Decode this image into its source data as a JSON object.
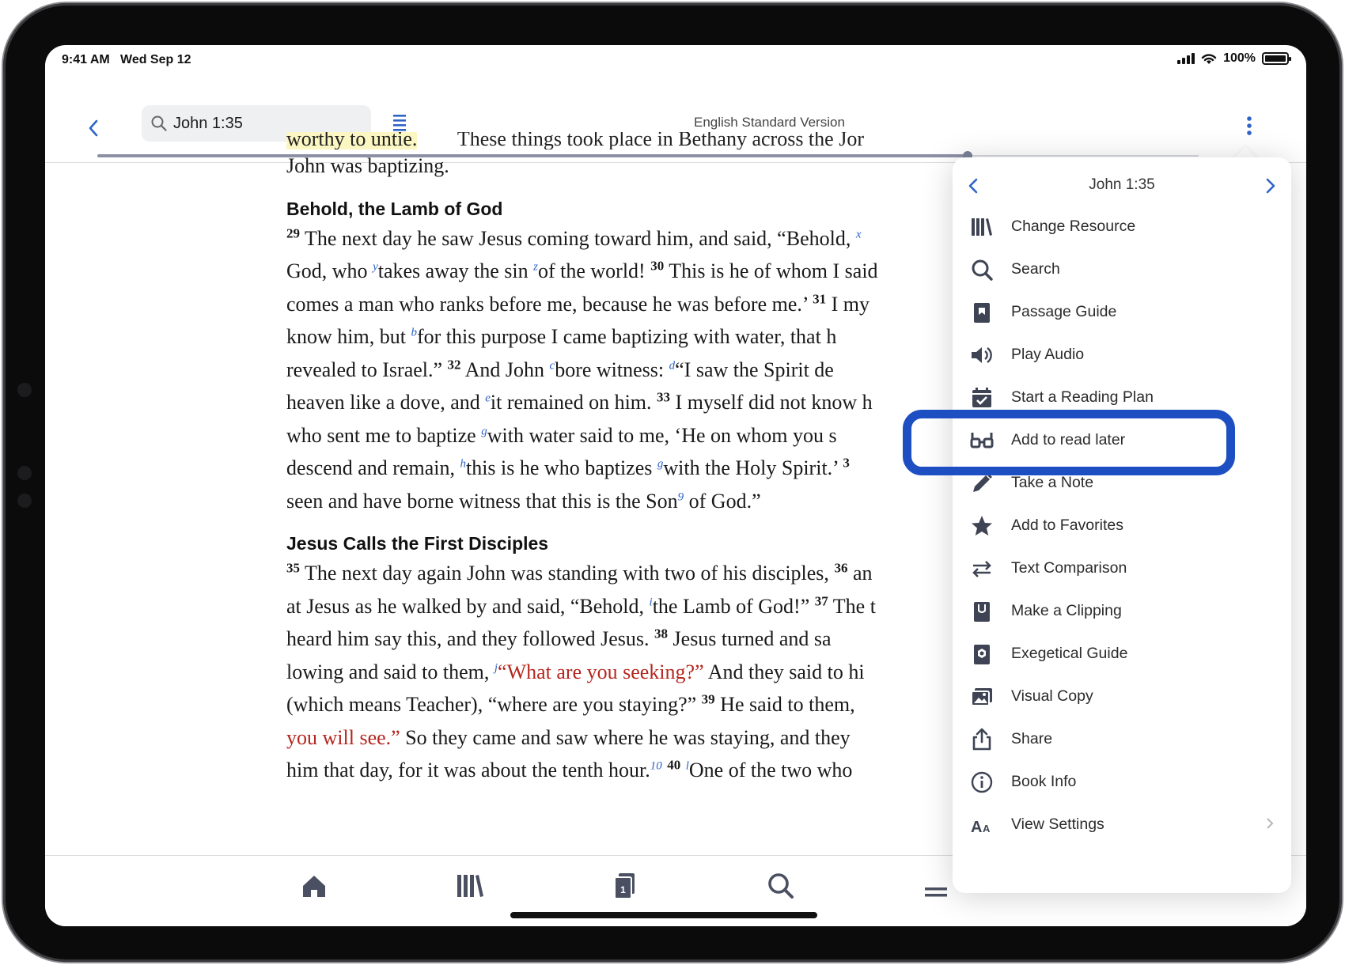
{
  "status_bar": {
    "time": "9:41 AM",
    "date": "Wed Sep 12",
    "battery": "100%"
  },
  "nav": {
    "search_value": "John 1:35",
    "version_title": "English Standard Version",
    "reading_progress": 0.79
  },
  "reader": {
    "cut_line_highlight": "worthy to untie.",
    "cut_line_rest": "These things took place in Bethany across the Jor",
    "line_intro": "John was baptizing.",
    "heading_1": "Behold, the Lamb of God",
    "heading_2": "Jesus Calls the First Disciples",
    "p1": {
      "l1a": "The next day he saw Jesus coming toward him, and said, “Behold,",
      "v29": "29",
      "fx": "x",
      "l2a": "God, who",
      "fy": "y",
      "l2b": "takes away the sin",
      "fz": "z",
      "l2c": "of the world!",
      "v30": "30",
      "l2d": "This is he of whom I said",
      "l3a": "comes a man who ranks before me, because he was before me.’",
      "v31": "31",
      "l3b": "I my",
      "l4a": "know him, but",
      "fb": "b",
      "l4b": "for this purpose I came baptizing with water, that h",
      "l5a": "revealed to Israel.”",
      "v32": "32",
      "l5b": "And John",
      "fc": "c",
      "l5c": "bore witness:",
      "fd": "d",
      "l5d": "“I saw the Spirit de",
      "l6a": "heaven like a dove, and",
      "fe": "e",
      "l6b": "it remained on him.",
      "v33": "33",
      "l6c": "I myself did not know h",
      "l7a": "who sent me to baptize",
      "fg": "g",
      "l7b": "with water said to me, ‘He on whom you s",
      "l8a": "descend and remain,",
      "fh": "h",
      "l8b": "this is he who baptizes",
      "fg2": "g",
      "l8c": "with the Holy Spirit.’",
      "v34": "3",
      "l9a": "seen and have borne witness that this is the Son",
      "f9": "9",
      "l9b": "of God.”"
    },
    "p2": {
      "v35": "35",
      "l1a": "The next day again John was standing with two of his disciples,",
      "v36": "36",
      "l1b": "an",
      "l2a": "at Jesus as he walked by and said, “Behold,",
      "fi": "i",
      "l2b": "the Lamb of God!”",
      "v37": "37",
      "l2c": "The t",
      "l3a": "heard him say this, and they followed Jesus.",
      "v38": "38",
      "l3b": "Jesus turned and sa",
      "l4a": "lowing and said to them,",
      "fj": "j",
      "l4red": "“What are you seeking?”",
      "l4b": "And they said to hi",
      "l5a": "(which means Teacher), “where are you staying?”",
      "v39": "39",
      "l5b": "He said to them,",
      "l6red": "you will see.”",
      "l6b": "So they came and saw where he was staying, and they",
      "l7a": "him that day, for it was about the tenth hour.",
      "f10": "10",
      "v40": "40",
      "fl": "l",
      "l7b": "One of the two who"
    }
  },
  "menu": {
    "title": "John 1:35",
    "items": [
      {
        "label": "Change Resource",
        "icon": "library-icon"
      },
      {
        "label": "Search",
        "icon": "search-icon"
      },
      {
        "label": "Passage Guide",
        "icon": "passage-guide-icon"
      },
      {
        "label": "Play Audio",
        "icon": "speaker-icon"
      },
      {
        "label": "Start a Reading Plan",
        "icon": "calendar-check-icon"
      },
      {
        "label": "Add to read later",
        "icon": "glasses-icon"
      },
      {
        "label": "Take a Note",
        "icon": "pencil-icon"
      },
      {
        "label": "Add to Favorites",
        "icon": "star-icon"
      },
      {
        "label": "Text Comparison",
        "icon": "swap-arrows-icon"
      },
      {
        "label": "Make a Clipping",
        "icon": "clipping-icon"
      },
      {
        "label": "Exegetical Guide",
        "icon": "exegetical-guide-icon"
      },
      {
        "label": "Visual Copy",
        "icon": "visual-copy-icon"
      },
      {
        "label": "Share",
        "icon": "share-icon"
      },
      {
        "label": "Book Info",
        "icon": "info-icon"
      },
      {
        "label": "View Settings",
        "icon": "text-size-icon"
      }
    ],
    "highlighted_item": "Take a Note"
  },
  "tabbar": {
    "documents_badge": "1"
  },
  "colors": {
    "accent": "#2e63c6",
    "icon_gray": "#3f4454",
    "highlight_ring": "#1e4fc2",
    "words_of_christ": "#b5261e",
    "verse_highlight": "#fbf6c2"
  }
}
